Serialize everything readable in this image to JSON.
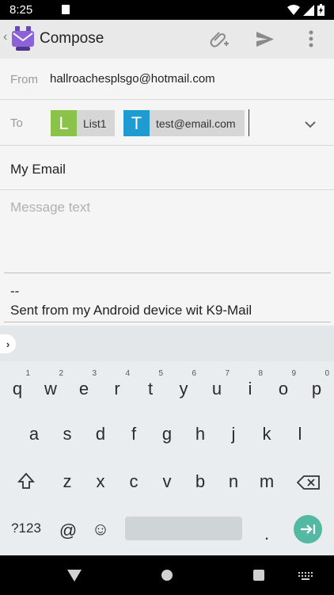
{
  "status_bar": {
    "time": "8:25"
  },
  "toolbar": {
    "back": "‹",
    "title": "Compose"
  },
  "from": {
    "label": "From",
    "value": "hallroachesplsgo@hotmail.com"
  },
  "to": {
    "label": "To",
    "chips": [
      {
        "initial": "L",
        "text": "List1",
        "color": "#8bc34a"
      },
      {
        "initial": "T",
        "text": "test@email.com",
        "color": "#1e9bd0"
      }
    ]
  },
  "subject": {
    "value": "My Email"
  },
  "message": {
    "placeholder": "Message text"
  },
  "signature": {
    "line1": "--",
    "line2": "Sent from my Android device wit K9-Mail"
  },
  "keyboard": {
    "row1": [
      {
        "ch": "q",
        "num": "1"
      },
      {
        "ch": "w",
        "num": "2"
      },
      {
        "ch": "e",
        "num": "3"
      },
      {
        "ch": "r",
        "num": "4"
      },
      {
        "ch": "t",
        "num": "5"
      },
      {
        "ch": "y",
        "num": "6"
      },
      {
        "ch": "u",
        "num": "7"
      },
      {
        "ch": "i",
        "num": "8"
      },
      {
        "ch": "o",
        "num": "9"
      },
      {
        "ch": "p",
        "num": "0"
      }
    ],
    "row2": [
      "a",
      "s",
      "d",
      "f",
      "g",
      "h",
      "j",
      "k",
      "l"
    ],
    "row3": [
      "z",
      "x",
      "c",
      "v",
      "b",
      "n",
      "m"
    ],
    "symbols": "?123",
    "at": "@",
    "emoji": "☺",
    "period": "."
  }
}
